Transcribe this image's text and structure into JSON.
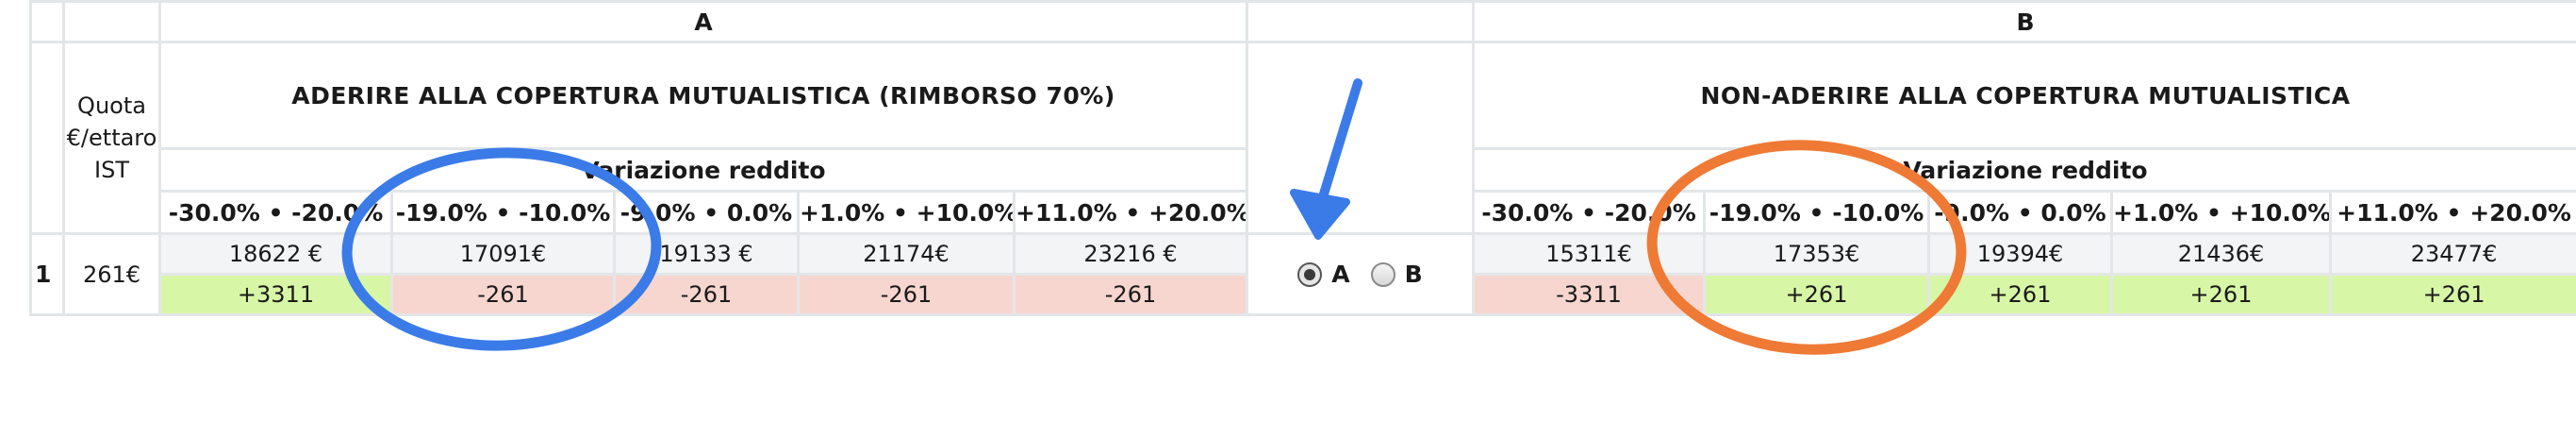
{
  "header": {
    "col_a": "A",
    "col_b": "B"
  },
  "quota_header": "Quota €/ettaro IST",
  "option_a": {
    "title": "ADERIRE ALLA COPERTURA MUTUALISTICA (RIMBORSO 70%)"
  },
  "option_b": {
    "title": "NON-ADERIRE ALLA COPERTURA MUTUALISTICA"
  },
  "variation_label": "Variazione reddito",
  "ranges": [
    "-30.0% • -20.0%",
    "-19.0% • -10.0%",
    "-9.0% • 0.0%",
    "+1.0% • +10.0%",
    "+11.0% • +20.0%"
  ],
  "row": {
    "number": "1",
    "quota": "261€",
    "a_values": [
      "18622 €",
      "17091€",
      "19133 €",
      "21174€",
      "23216 €"
    ],
    "a_deltas": [
      "+3311",
      "-261",
      "-261",
      "-261",
      "-261"
    ],
    "b_values": [
      "15311€",
      "17353€",
      "19394€",
      "21436€",
      "23477€"
    ],
    "b_deltas": [
      "-3311",
      "+261",
      "+261",
      "+261",
      "+261"
    ]
  },
  "choice": {
    "option_a_label": "A",
    "option_b_label": "B",
    "selected": "A"
  },
  "annotation_colors": {
    "blue": "#3b7be8",
    "orange": "#ee7a35"
  },
  "colors": {
    "positive": "#d8f7a6",
    "negative": "#f7d6cf",
    "neutral": "#f2f4f5"
  }
}
